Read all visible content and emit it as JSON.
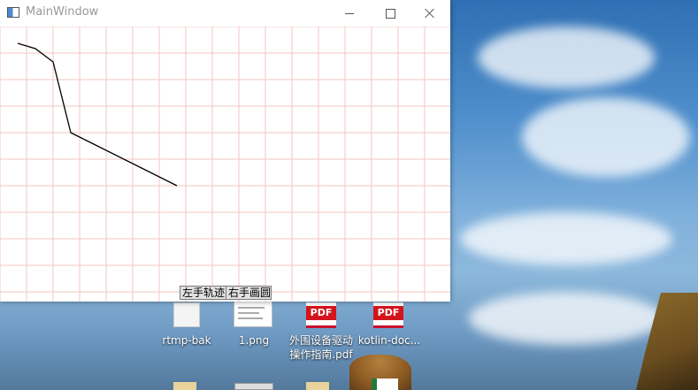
{
  "window": {
    "title": "MainWindow",
    "buttons": {
      "left_track": "左手轨迹",
      "right_circle": "右手画圆"
    }
  },
  "trajectory": {
    "points": [
      [
        20,
        49
      ],
      [
        40,
        55
      ],
      [
        60,
        70
      ],
      [
        80,
        150
      ],
      [
        200,
        210
      ]
    ],
    "line_color": "#000000"
  },
  "grid": {
    "color": "#f5c6c6"
  },
  "desktop": {
    "icons": [
      {
        "label": "rtmp-bak",
        "kind": "blank-file-icon"
      },
      {
        "label": "1.png",
        "kind": "image-file-icon"
      },
      {
        "label_line1": "外围设备驱动",
        "label_line2": "操作指南.pdf",
        "kind": "pdf-file-icon",
        "badge": "PDF"
      },
      {
        "label": "kotlin-doc...",
        "kind": "pdf-file-icon",
        "badge": "PDF"
      }
    ]
  }
}
